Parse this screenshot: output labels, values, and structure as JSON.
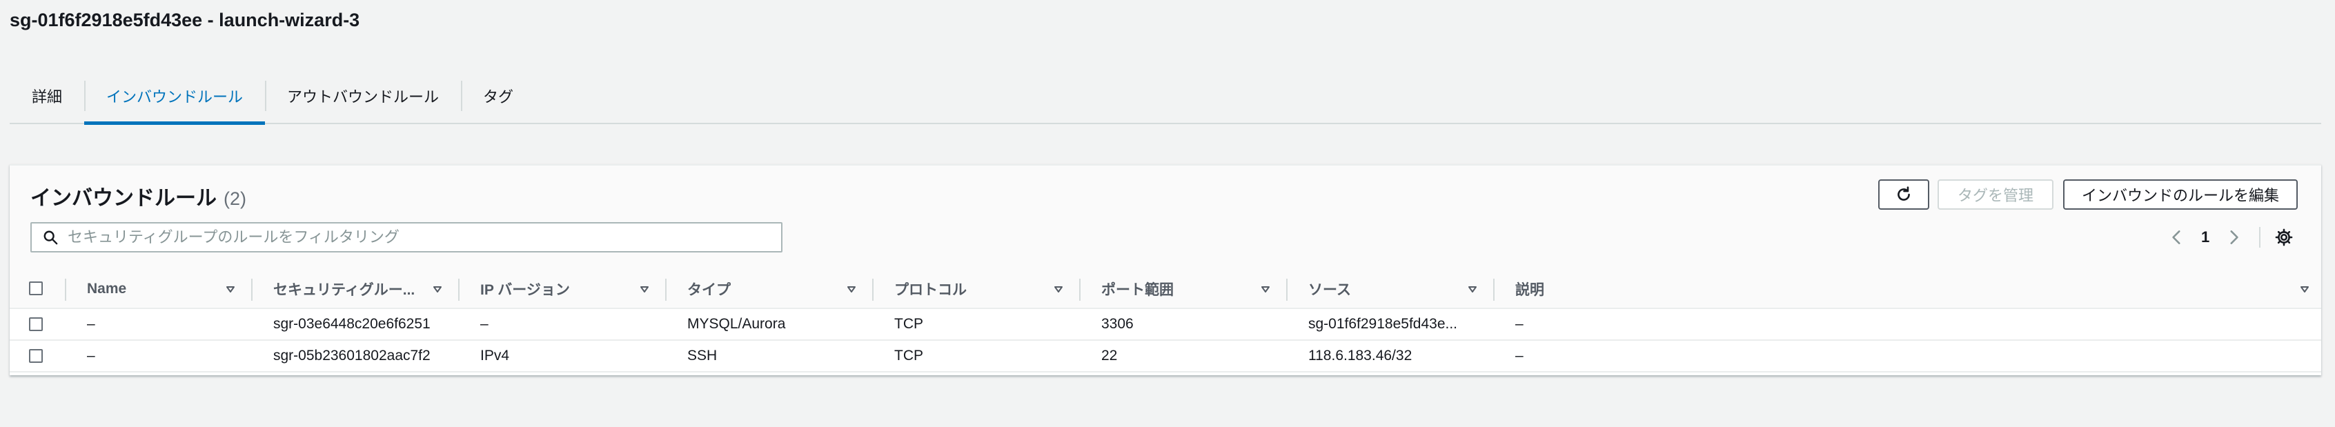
{
  "page": {
    "title": "sg-01f6f2918e5fd43ee - launch-wizard-3"
  },
  "tabs": [
    {
      "label": "詳細"
    },
    {
      "label": "インバウンドルール"
    },
    {
      "label": "アウトバウンドルール"
    },
    {
      "label": "タグ"
    }
  ],
  "panel": {
    "title": "インバウンドルール",
    "count": "(2)",
    "manage_tags_label": "タグを管理",
    "edit_rules_label": "インバウンドのルールを編集",
    "search_placeholder": "セキュリティグループのルールをフィルタリング",
    "page_number": "1"
  },
  "columns": [
    "Name",
    "セキュリティグルー...",
    "IP バージョン",
    "タイプ",
    "プロトコル",
    "ポート範囲",
    "ソース",
    "説明"
  ],
  "rows": [
    [
      "–",
      "sgr-03e6448c20e6f6251",
      "–",
      "MYSQL/Aurora",
      "TCP",
      "3306",
      "sg-01f6f2918e5fd43e...",
      "–"
    ],
    [
      "–",
      "sgr-05b23601802aac7f2",
      "IPv4",
      "SSH",
      "TCP",
      "22",
      "118.6.183.46/32",
      "–"
    ]
  ],
  "colors": {
    "accent": "#0073bb",
    "text": "#16191f",
    "muted": "#687078",
    "border": "#d5dbdb",
    "background": "#f2f3f3"
  }
}
